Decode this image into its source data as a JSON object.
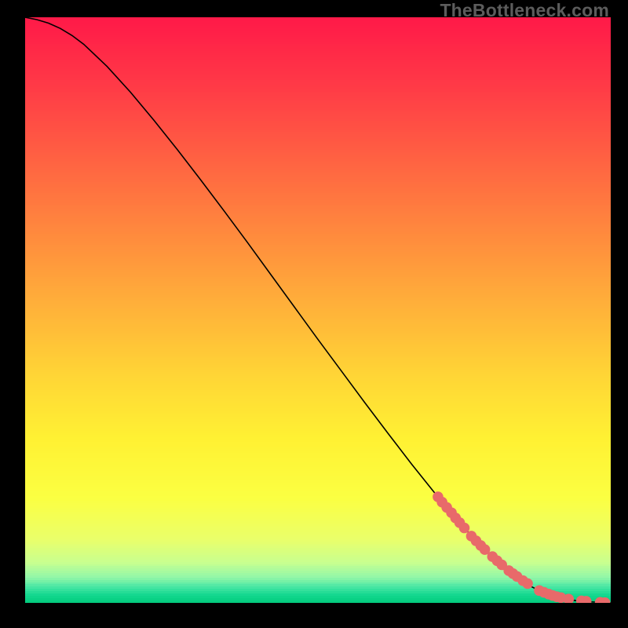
{
  "watermark": "TheBottleneck.com",
  "colors": {
    "marker": "#e86a6a",
    "curve": "#000000",
    "frame": "#000000"
  },
  "chart_data": {
    "type": "line",
    "title": "",
    "xlabel": "",
    "ylabel": "",
    "xlim": [
      0,
      100
    ],
    "ylim": [
      0,
      100
    ],
    "grid": false,
    "legend": false,
    "series": [
      {
        "name": "bottleneck-curve",
        "x": [
          0,
          2,
          4,
          6,
          8,
          10,
          14,
          18,
          22,
          26,
          30,
          34,
          38,
          42,
          46,
          50,
          54,
          58,
          62,
          66,
          70,
          74,
          77,
          80,
          83,
          86,
          88,
          90,
          92,
          94,
          96,
          98,
          100
        ],
        "y": [
          100,
          99.6,
          99.0,
          98.1,
          96.9,
          95.4,
          91.6,
          87.2,
          82.4,
          77.4,
          72.2,
          66.9,
          61.5,
          56.0,
          50.5,
          45.0,
          39.6,
          34.2,
          28.9,
          23.7,
          18.7,
          13.9,
          10.6,
          7.6,
          5.0,
          3.0,
          2.0,
          1.2,
          0.7,
          0.4,
          0.2,
          0.1,
          0.0
        ]
      }
    ],
    "markers": {
      "name": "highlighted-range",
      "x": [
        70.5,
        71.2,
        72.0,
        72.8,
        73.5,
        74.2,
        75.0,
        76.2,
        77.0,
        77.8,
        78.5,
        79.8,
        80.6,
        81.4,
        82.6,
        83.3,
        84.0,
        85.0,
        85.8,
        87.8,
        88.6,
        89.4,
        90.1,
        90.8,
        91.5,
        92.8,
        95.0,
        95.8,
        98.2,
        99.0
      ],
      "y": [
        18.1,
        17.2,
        16.3,
        15.4,
        14.5,
        13.7,
        12.8,
        11.4,
        10.6,
        9.8,
        9.1,
        7.9,
        7.2,
        6.5,
        5.5,
        5.0,
        4.5,
        3.8,
        3.3,
        2.1,
        1.8,
        1.5,
        1.25,
        1.05,
        0.9,
        0.65,
        0.35,
        0.28,
        0.09,
        0.05
      ]
    },
    "gradient_stops": [
      {
        "pos": 0.0,
        "color": "#ff1a48"
      },
      {
        "pos": 0.1,
        "color": "#ff3547"
      },
      {
        "pos": 0.22,
        "color": "#ff5b43"
      },
      {
        "pos": 0.35,
        "color": "#ff843e"
      },
      {
        "pos": 0.48,
        "color": "#ffad3a"
      },
      {
        "pos": 0.6,
        "color": "#ffd236"
      },
      {
        "pos": 0.72,
        "color": "#fff133"
      },
      {
        "pos": 0.82,
        "color": "#fbff42"
      },
      {
        "pos": 0.89,
        "color": "#eaff6a"
      },
      {
        "pos": 0.93,
        "color": "#c8ff90"
      },
      {
        "pos": 0.955,
        "color": "#92f7a8"
      },
      {
        "pos": 0.972,
        "color": "#48e6a4"
      },
      {
        "pos": 0.985,
        "color": "#14d88f"
      },
      {
        "pos": 1.0,
        "color": "#00c97a"
      }
    ]
  }
}
